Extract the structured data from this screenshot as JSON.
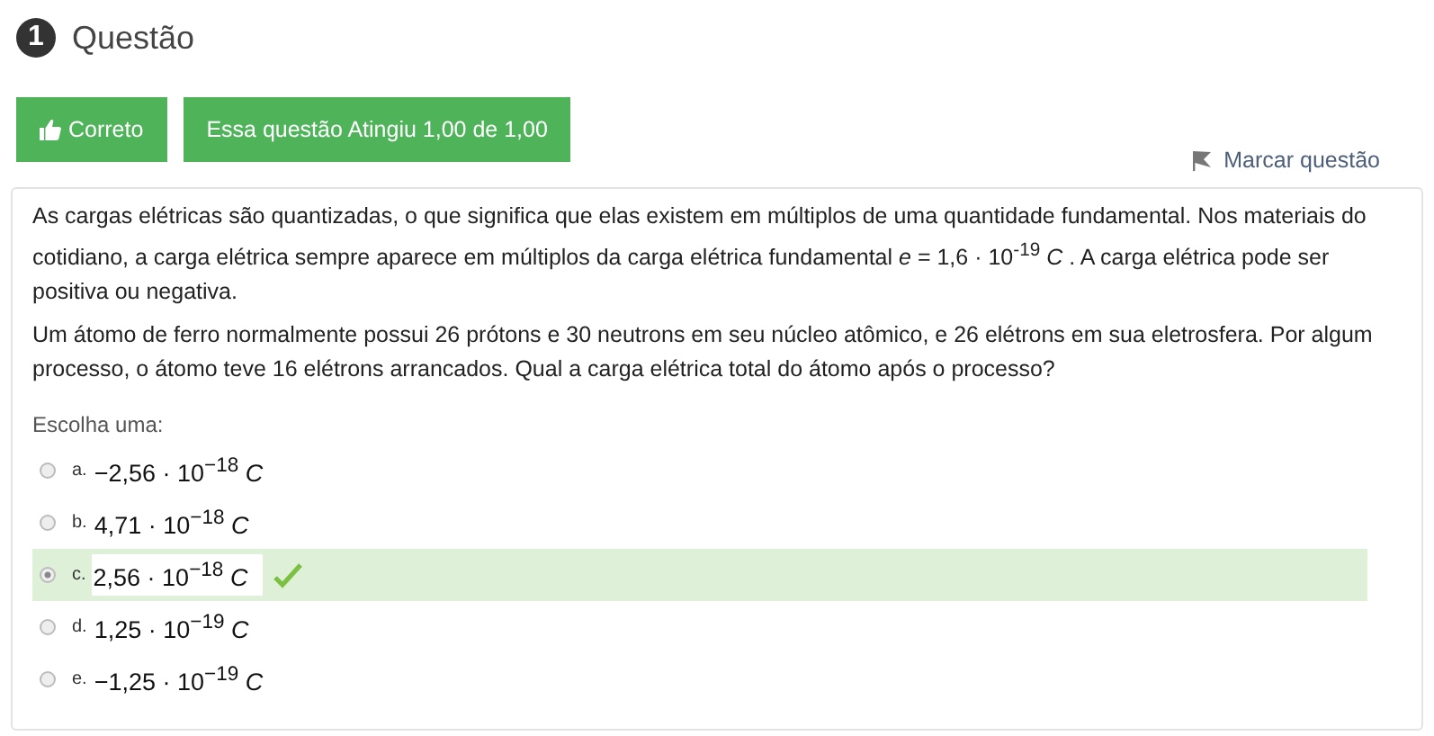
{
  "question": {
    "number": "1",
    "title": "Questão"
  },
  "status_buttons": [
    {
      "kind": "correct",
      "label": "Correto"
    },
    {
      "kind": "grade",
      "label": "Essa questão Atingiu 1,00 de 1,00"
    }
  ],
  "flag_link": "Marcar questão",
  "paragraphs": [
    "As cargas elétricas são quantizadas, o que significa que elas existem em múltiplos de uma quantidade fundamental. Nos materiais do cotidiano, a carga elétrica sempre aparece em múltiplos da carga elétrica fundamental  *e* = 1,6 · 10$^{-19}$ *C*  . A carga elétrica pode ser positiva ou negativa.",
    "Um átomo de ferro normalmente possui 26 prótons e 30 neutrons em seu núcleo atômico, e 26 elétrons em sua eletrosfera. Por algum processo, o átomo teve 16 elétrons arrancados. Qual a carga elétrica total do átomo após o processo?"
  ],
  "prompt": "Escolha uma:",
  "options": [
    {
      "letter": "a.",
      "answer": "−2,56 · 10$^{−18}$ *C*",
      "selected": false,
      "correct": false
    },
    {
      "letter": "b.",
      "answer": "4,71 · 10$^{−18}$ *C*",
      "selected": false,
      "correct": false
    },
    {
      "letter": "c.",
      "answer": "2,56 · 10$^{−18}$ *C*",
      "selected": true,
      "correct": true
    },
    {
      "letter": "d.",
      "answer": "1,25 · 10$^{−19}$ *C*",
      "selected": false,
      "correct": false
    },
    {
      "letter": "e.",
      "answer": "−1,25 · 10$^{−19}$ *C*",
      "selected": false,
      "correct": false
    }
  ]
}
